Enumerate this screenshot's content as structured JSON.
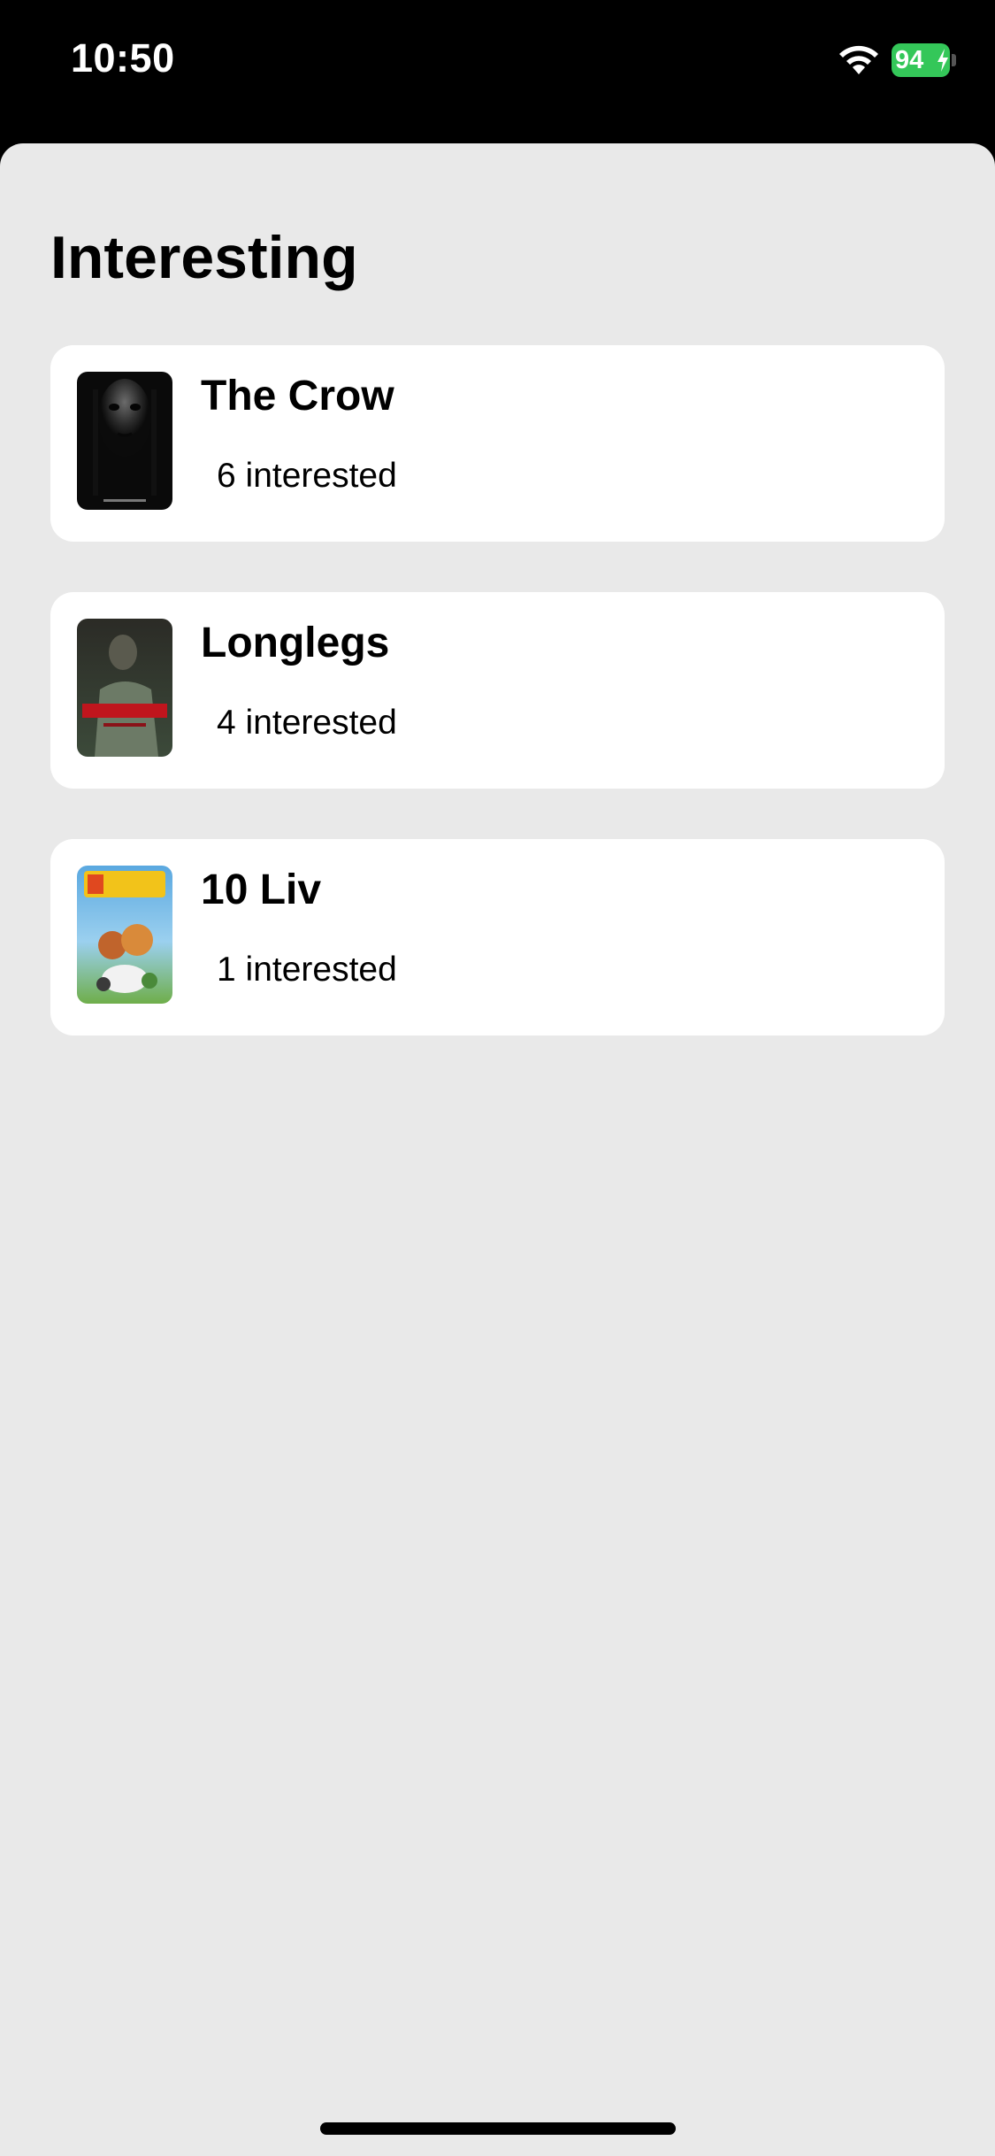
{
  "status_bar": {
    "time": "10:50",
    "battery_level": "94",
    "battery_color": "#34c759",
    "wifi_icon": "wifi-icon",
    "charging_icon": "bolt-icon"
  },
  "page": {
    "title": "Interesting",
    "background": "#e9e9e9"
  },
  "movies": [
    {
      "title": "The Crow",
      "interested": "6 interested",
      "poster_icon": "poster-the-crow"
    },
    {
      "title": "Longlegs",
      "interested": "4 interested",
      "poster_icon": "poster-longlegs"
    },
    {
      "title": "10 Liv",
      "interested": "1 interested",
      "poster_icon": "poster-10-liv"
    }
  ]
}
